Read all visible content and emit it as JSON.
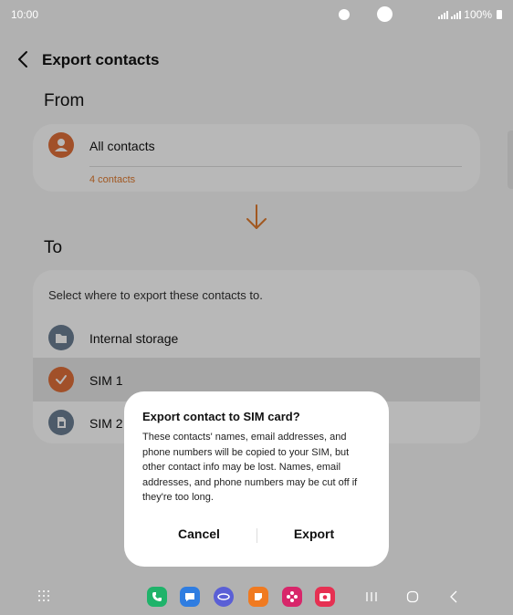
{
  "status_bar": {
    "time": "10:00",
    "battery": "100%"
  },
  "app_bar": {
    "title": "Export contacts"
  },
  "from_section": {
    "label": "From",
    "source": {
      "name": "All contacts",
      "count": "4 contacts"
    }
  },
  "to_section": {
    "label": "To",
    "prompt": "Select where to export these contacts to.",
    "options": [
      {
        "label": "Internal storage",
        "icon": "folder-icon"
      },
      {
        "label": "SIM 1",
        "icon": "sim-check-icon"
      },
      {
        "label": "SIM 2",
        "icon": "sim-card-icon"
      }
    ]
  },
  "dialog": {
    "title": "Export contact to SIM card?",
    "body": "These contacts' names, email addresses, and phone numbers will be copied to your SIM, but other contact info may be lost. Names, email addresses, and phone numbers may be cut off if they're too long.",
    "cancel_label": "Cancel",
    "confirm_label": "Export"
  },
  "nav_bar": {
    "apps": [
      "phone-icon",
      "messages-icon",
      "internet-icon",
      "notes-icon",
      "gallery-icon",
      "camera-icon"
    ]
  },
  "colors": {
    "accent": "#e07a2f",
    "sim1_avatar": "#e0703a",
    "slate_avatar": "#6b7f94",
    "phone_app": "#1fb36a",
    "messages_app": "#2f7de1",
    "internet_app": "#5a5fd6",
    "notes_app": "#f07a20",
    "gallery_app": "#d8266a",
    "camera_app": "#e63052"
  }
}
